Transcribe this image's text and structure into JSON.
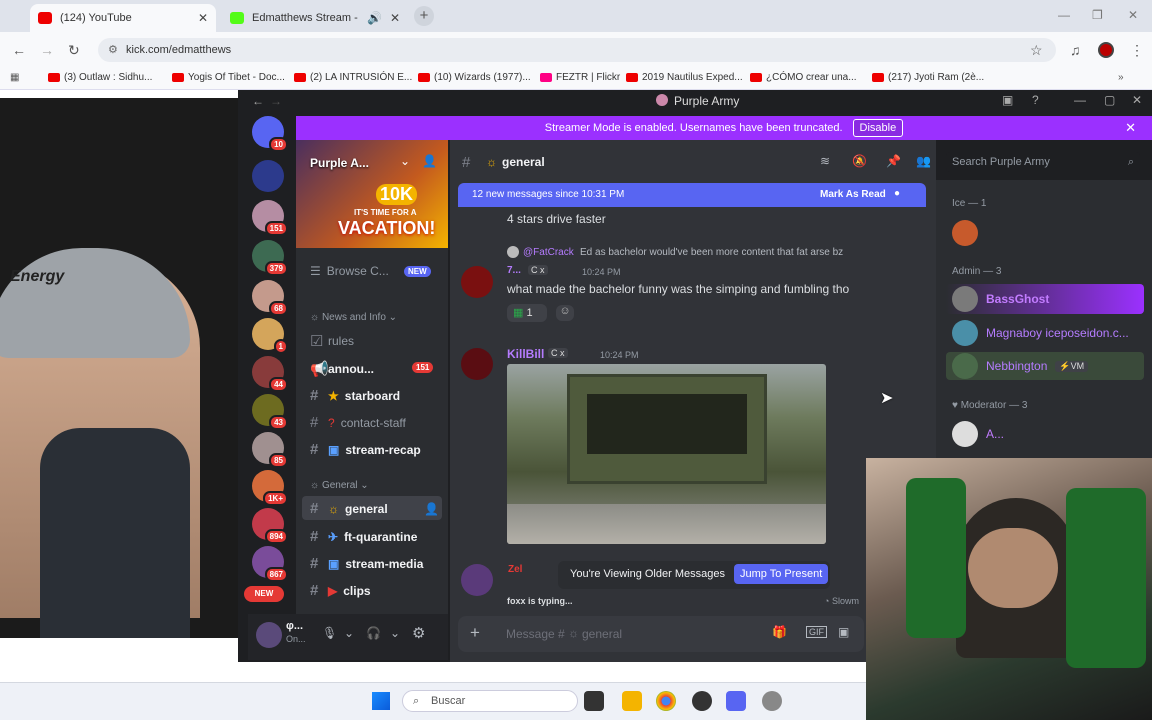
{
  "browser": {
    "tabs": [
      {
        "label": "(124) YouTube",
        "active": true
      },
      {
        "label": "Edmatthews Stream - Watc",
        "active": false
      }
    ],
    "url": "kick.com/edmatthews",
    "bookmarks": [
      "(3) Outlaw : Sidhu...",
      "Yogis Of Tibet - Doc...",
      "(2) LA INTRUSIÓN E...",
      "(10) Wizards (1977)...",
      "FEZTR | Flickr",
      "2019 Nautilus Exped...",
      "¿CÓMO crear una...",
      "(217) Jyoti Ram (2è..."
    ]
  },
  "discord": {
    "window_title": "Purple Army",
    "banner": {
      "text": "Streamer Mode is enabled. Usernames have been truncated.",
      "button": "Disable"
    },
    "server_badges": [
      "10",
      "151",
      "379",
      "68",
      "1",
      "44",
      "43",
      "85",
      "1K+",
      "894",
      "867",
      "NEW"
    ],
    "server": {
      "name": "Purple A...",
      "promo_line1": "10K",
      "promo_line2": "IT'S TIME FOR A",
      "promo_line3": "VACATION!"
    },
    "channels": {
      "browse": "Browse C...",
      "browse_badge": "NEW",
      "cat_news": "News and Info",
      "news_items": [
        {
          "label": "rules",
          "icon": "page-icon"
        },
        {
          "label": "annou...",
          "icon": "megaphone-icon",
          "badge": "151"
        },
        {
          "label": "starboard",
          "icon": "star-icon"
        },
        {
          "label": "contact-staff",
          "icon": "question-icon"
        },
        {
          "label": "stream-recap",
          "icon": "tv-icon"
        }
      ],
      "cat_general": "General",
      "general_items": [
        {
          "label": "general",
          "selected": true
        },
        {
          "label": "ft-quarantine"
        },
        {
          "label": "stream-media"
        },
        {
          "label": "clips"
        }
      ]
    },
    "user_panel": {
      "name": "φ...",
      "status": "On..."
    },
    "chat": {
      "channel": "general",
      "new_banner": "12 new messages since 10:31 PM",
      "mark_read": "Mark As Read",
      "msg0": "4 stars drive faster",
      "reply_user": "@FatCrack",
      "reply_text": "Ed as bachelor would've been more content that fat arse bz",
      "msg1_user": "7...",
      "msg1_tag": "C x",
      "msg1_time": "10:24 PM",
      "msg1_text": "what made the bachelor funny was the simping and fumbling tho",
      "reaction_count": "1",
      "msg2_user": "KillBill",
      "msg2_tag": "C x",
      "msg2_time": "10:24 PM",
      "msg3_user": "Zel",
      "older_text": "You're Viewing Older Messages",
      "jump": "Jump To Present",
      "typing": "foxx is typing...",
      "slowmode": "Slowm",
      "composer": "Message #",
      "composer_channel": "general"
    },
    "search_placeholder": "Search Purple Army",
    "members": {
      "ice": "Ice — 1",
      "admin": "Admin — 3",
      "admins": [
        {
          "name": "BassGhost",
          "color": "#c27cff"
        },
        {
          "name": "Magnaboy iceposeidon.c...",
          "color": "#b57cff"
        },
        {
          "name": "Nebbington",
          "color": "#b57cff",
          "tag": "VM"
        }
      ],
      "mod": "Moderator — 3",
      "mods": [
        {
          "name": "A...",
          "color": "#c27cff"
        }
      ]
    }
  },
  "taskbar": {
    "search": "Buscar"
  },
  "webcam_overlay": {
    "cap_text": "Energy"
  }
}
